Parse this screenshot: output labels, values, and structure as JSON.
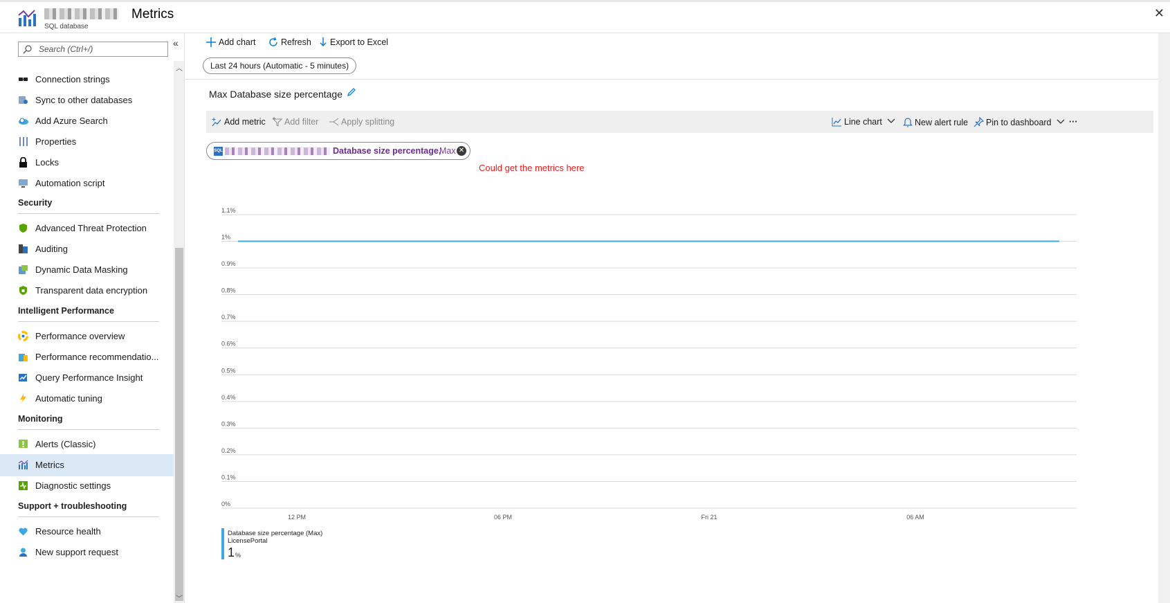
{
  "header": {
    "title": "Metrics",
    "subtitle": "SQL database",
    "close_glyph": "✕"
  },
  "sidebar": {
    "search_placeholder": "Search (Ctrl+/)",
    "collapse_glyph": "«",
    "items_top": [
      {
        "label": "Connection strings",
        "icon": "connection-strings-icon"
      },
      {
        "label": "Sync to other databases",
        "icon": "sync-icon"
      },
      {
        "label": "Add Azure Search",
        "icon": "azure-search-icon"
      },
      {
        "label": "Properties",
        "icon": "properties-icon"
      },
      {
        "label": "Locks",
        "icon": "lock-icon"
      },
      {
        "label": "Automation script",
        "icon": "automation-script-icon"
      }
    ],
    "sections": [
      {
        "title": "Security",
        "items": [
          {
            "label": "Advanced Threat Protection",
            "icon": "shield-icon"
          },
          {
            "label": "Auditing",
            "icon": "auditing-icon"
          },
          {
            "label": "Dynamic Data Masking",
            "icon": "data-masking-icon"
          },
          {
            "label": "Transparent data encryption",
            "icon": "encryption-shield-icon"
          }
        ]
      },
      {
        "title": "Intelligent Performance",
        "items": [
          {
            "label": "Performance overview",
            "icon": "performance-overview-icon"
          },
          {
            "label": "Performance recommendatio...",
            "icon": "performance-recommendations-icon"
          },
          {
            "label": "Query Performance Insight",
            "icon": "query-insight-icon"
          },
          {
            "label": "Automatic tuning",
            "icon": "lightning-icon"
          }
        ]
      },
      {
        "title": "Monitoring",
        "items": [
          {
            "label": "Alerts (Classic)",
            "icon": "alert-icon"
          },
          {
            "label": "Metrics",
            "icon": "metrics-icon",
            "selected": true
          },
          {
            "label": "Diagnostic settings",
            "icon": "diagnostic-settings-icon"
          }
        ]
      },
      {
        "title": "Support + troubleshooting",
        "items": [
          {
            "label": "Resource health",
            "icon": "heart-icon"
          },
          {
            "label": "New support request",
            "icon": "support-person-icon"
          }
        ]
      }
    ]
  },
  "toolbar": {
    "add_chart": "Add chart",
    "refresh": "Refresh",
    "export": "Export to Excel",
    "time_range": "Last 24 hours (Automatic - 5 minutes)"
  },
  "chart": {
    "title": "Max Database size percentage",
    "add_metric": "Add metric",
    "add_filter": "Add filter",
    "apply_splitting": "Apply splitting",
    "chart_type": "Line chart",
    "new_alert": "New alert rule",
    "pin": "Pin to dashboard",
    "more": "···",
    "pill_metric": "Database size percentage,",
    "pill_agg": "Max",
    "pill_remove": "✕",
    "annotation": "Could get the metrics here",
    "legend_title": "Database size percentage (Max)",
    "legend_resource": "LicensePortal",
    "legend_value": "1",
    "legend_unit": "%"
  },
  "colors": {
    "accent": "#0078d4",
    "series": "#3da9e3",
    "annotation": "#e81b1b",
    "selected_bg": "#dbe9f7"
  },
  "chart_data": {
    "type": "line",
    "title": "Max Database size percentage",
    "ylim": [
      0,
      1.1
    ],
    "yticks": [
      0,
      0.1,
      0.2,
      0.3,
      0.4,
      0.5,
      0.6,
      0.7,
      0.8,
      0.9,
      1.0,
      1.1
    ],
    "ytick_labels": [
      "0%",
      "0.1%",
      "0.2%",
      "0.3%",
      "0.4%",
      "0.5%",
      "0.6%",
      "0.7%",
      "0.8%",
      "0.9%",
      "1%",
      "1.1%"
    ],
    "xtick_labels": [
      "12 PM",
      "06 PM",
      "Fri 21",
      "06 AM"
    ],
    "series": [
      {
        "name": "Database size percentage (Max)",
        "x": [
          0,
          1
        ],
        "y": [
          1.0,
          1.0
        ]
      }
    ],
    "grid": true
  }
}
